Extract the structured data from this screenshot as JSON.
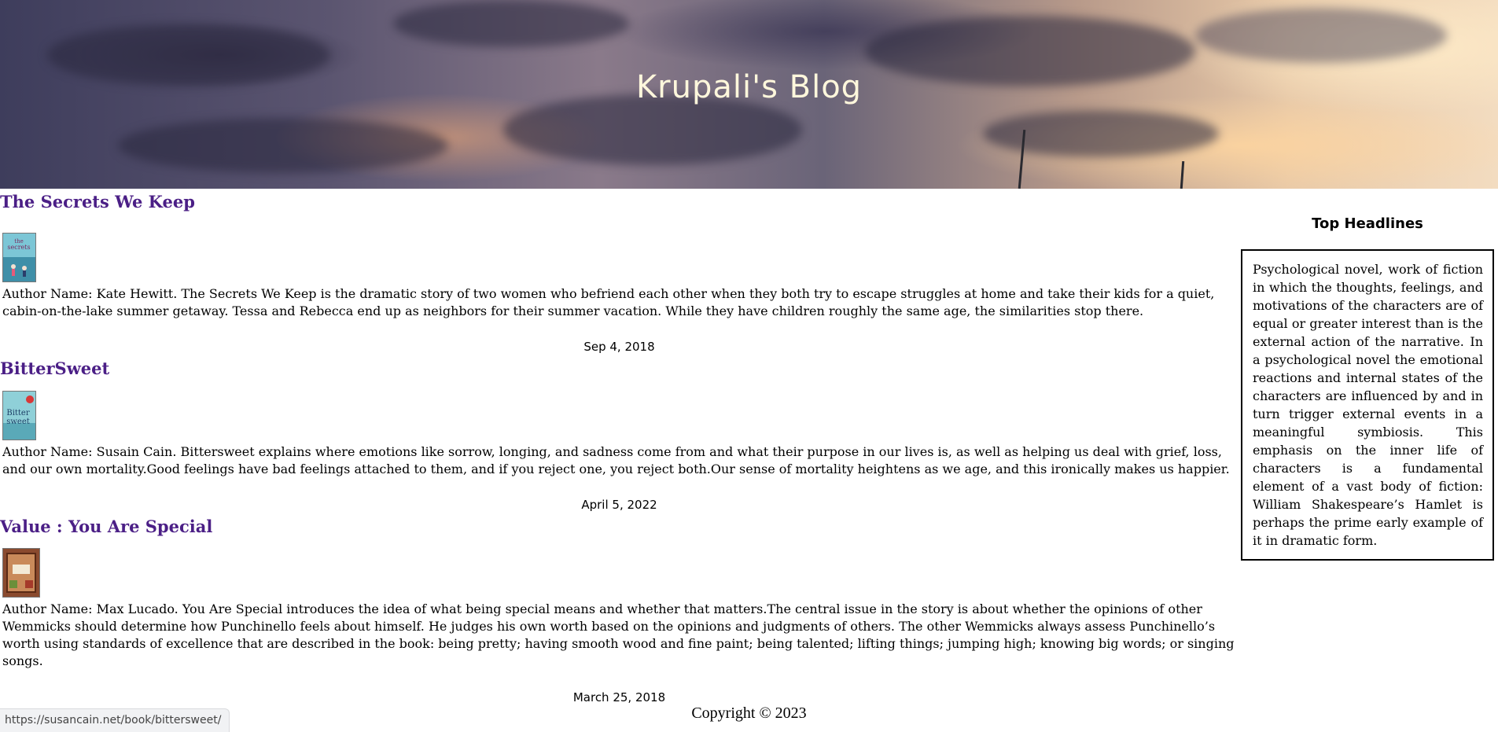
{
  "header": {
    "title": "Krupali's Blog"
  },
  "posts": [
    {
      "title": "The Secrets We Keep",
      "cover_alt": "The Secrets We Keep book cover",
      "body": "Author Name: Kate Hewitt. The Secrets We Keep is the dramatic story of two women who befriend each other when they both try to escape struggles at home and take their kids for a quiet, cabin-on-the-lake summer getaway. Tessa and Rebecca end up as neighbors for their summer vacation. While they have children roughly the same age, the similarities stop there.",
      "date": "Sep 4, 2018"
    },
    {
      "title": "BitterSweet",
      "cover_alt": "Bittersweet book cover",
      "body": "Author Name: Susain Cain. Bittersweet explains where emotions like sorrow, longing, and sadness come from and what their purpose in our lives is, as well as helping us deal with grief, loss, and our own mortality.Good feelings have bad feelings attached to them, and if you reject one, you reject both.Our sense of mortality heightens as we age, and this ironically makes us happier.",
      "date": "April 5, 2022"
    },
    {
      "title": "Value : You Are Special",
      "cover_alt": "You Are Special book cover",
      "body": "Author Name: Max Lucado. You Are Special introduces the idea of what being special means and whether that matters.The central issue in the story is about whether the opinions of other Wemmicks should determine how Punchinello feels about himself. He judges his own worth based on the opinions and judgments of others. The other Wemmicks always assess Punchinello’s worth using standards of excellence that are described in the book: being pretty; having smooth wood and fine paint; being talented; lifting things; jumping high; knowing big words; or singing songs.",
      "date": "March 25, 2018"
    }
  ],
  "sidebar": {
    "heading": "Top Headlines",
    "text": "Psychological novel, work of fiction in which the thoughts, feelings, and motivations of the characters are of equal or greater interest than is the external action of the narrative. In a psychological novel the emotional reactions and internal states of the characters are influenced by and in turn trigger external events in a meaningful symbiosis. This emphasis on the inner life of characters is a fundamental element of a vast body of fiction: William Shakespeare’s Hamlet is perhaps the prime early example of it in dramatic form."
  },
  "footer": {
    "copyright": "Copyright © 2023"
  },
  "status_bar": {
    "url": "https://susancain.net/book/bittersweet/"
  }
}
